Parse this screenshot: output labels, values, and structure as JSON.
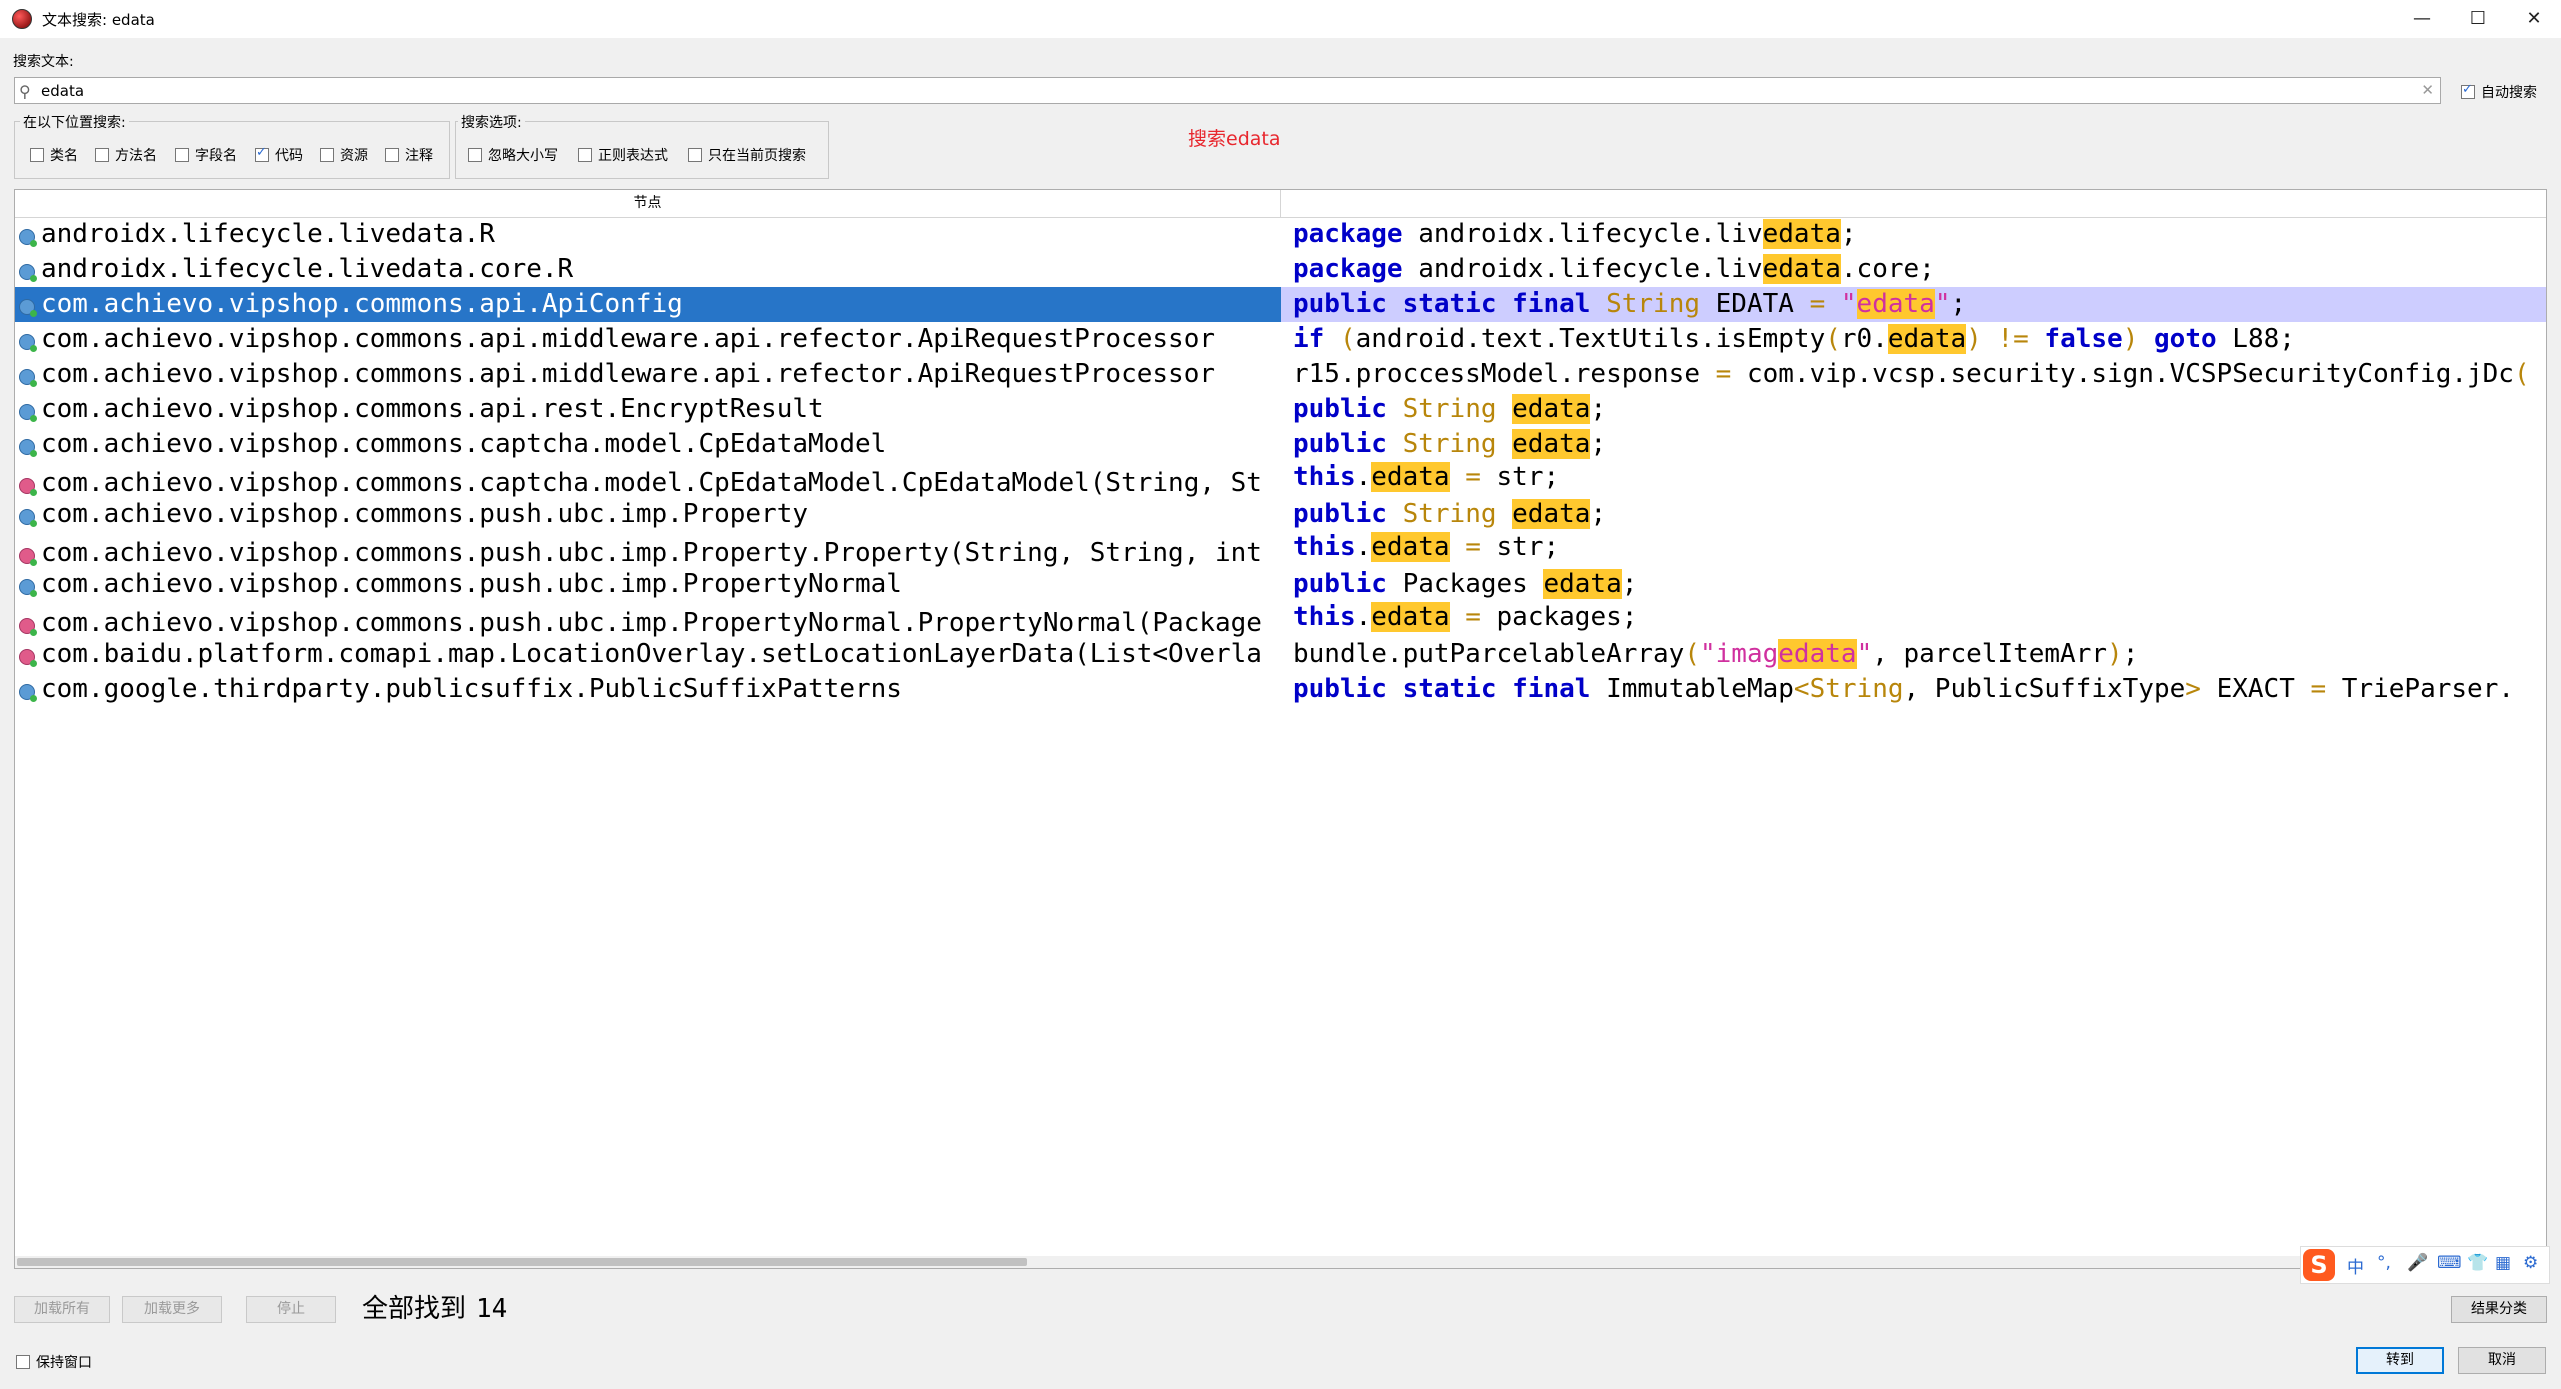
{
  "window": {
    "title": "文本搜索: edata",
    "minimize": "—",
    "maximize": "☐",
    "close": "✕"
  },
  "search": {
    "label": "搜索文本:",
    "value": "edata",
    "auto_search_label": "自动搜索",
    "auto_search_checked": true
  },
  "search_in": {
    "title": "在以下位置搜索:",
    "options": [
      {
        "label": "类名",
        "checked": false
      },
      {
        "label": "方法名",
        "checked": false
      },
      {
        "label": "字段名",
        "checked": false
      },
      {
        "label": "代码",
        "checked": true
      },
      {
        "label": "资源",
        "checked": false
      },
      {
        "label": "注释",
        "checked": false
      }
    ]
  },
  "search_options": {
    "title": "搜索选项:",
    "options": [
      {
        "label": "忽略大小写",
        "checked": false
      },
      {
        "label": "正则表达式",
        "checked": false
      },
      {
        "label": "只在当前页搜索",
        "checked": false
      }
    ]
  },
  "hint": "搜索edata",
  "results": {
    "column_node": "节点",
    "column_code": "",
    "rows": [
      {
        "icon": "class",
        "node": "androidx.lifecycle.livedata.R",
        "code": "package androidx.lifecycle.livedata;"
      },
      {
        "icon": "class",
        "node": "androidx.lifecycle.livedata.core.R",
        "code": "package androidx.lifecycle.livedata.core;"
      },
      {
        "icon": "class",
        "node": "com.achievo.vipshop.commons.api.ApiConfig",
        "code": "public static final String EDATA = \"edata\";",
        "selected": true
      },
      {
        "icon": "class",
        "node": "com.achievo.vipshop.commons.api.middleware.api.refector.ApiRequestProcessor",
        "code": "if (android.text.TextUtils.isEmpty(r0.edata) != false) goto L88;"
      },
      {
        "icon": "class",
        "node": "com.achievo.vipshop.commons.api.middleware.api.refector.ApiRequestProcessor",
        "code": "r15.proccessModel.response = com.vip.vcsp.security.sign.VCSPSecurityConfig.jDc("
      },
      {
        "icon": "class",
        "node": "com.achievo.vipshop.commons.api.rest.EncryptResult",
        "code": "public String edata;"
      },
      {
        "icon": "class",
        "node": "com.achievo.vipshop.commons.captcha.model.CpEdataModel",
        "code": "public String edata;"
      },
      {
        "icon": "method",
        "node": "com.achievo.vipshop.commons.captcha.model.CpEdataModel.CpEdataModel(String, St",
        "code": "this.edata = str;"
      },
      {
        "icon": "class",
        "node": "com.achievo.vipshop.commons.push.ubc.imp.Property",
        "code": "public String edata;"
      },
      {
        "icon": "method",
        "node": "com.achievo.vipshop.commons.push.ubc.imp.Property.Property(String, String, int",
        "code": "this.edata = str;"
      },
      {
        "icon": "class",
        "node": "com.achievo.vipshop.commons.push.ubc.imp.PropertyNormal",
        "code": "public Packages edata;"
      },
      {
        "icon": "method",
        "node": "com.achievo.vipshop.commons.push.ubc.imp.PropertyNormal.PropertyNormal(Package",
        "code": "this.edata = packages;"
      },
      {
        "icon": "method",
        "node": "com.baidu.platform.comapi.map.LocationOverlay.setLocationLayerData(List<Overla",
        "code": "bundle.putParcelableArray(\"imagedata\", parcelItemArr);"
      },
      {
        "icon": "class",
        "node": "com.google.thirdparty.publicsuffix.PublicSuffixPatterns",
        "code": "public static final ImmutableMap<String, PublicSuffixType> EXACT = TrieParser."
      }
    ]
  },
  "buttons": {
    "load_all": "加载所有",
    "load_more": "加载更多",
    "stop": "停止",
    "result_category": "结果分类",
    "goto": "转到",
    "cancel": "取消"
  },
  "status": {
    "found_label": "全部找到",
    "found_count": "14"
  },
  "keep_window": {
    "label": "保持窗口",
    "checked": false
  },
  "ime_bar": {
    "logo": "S",
    "mode": "中",
    "items": [
      "°,",
      "🎤",
      "⌨",
      "👕",
      "▦",
      "⚙"
    ]
  }
}
